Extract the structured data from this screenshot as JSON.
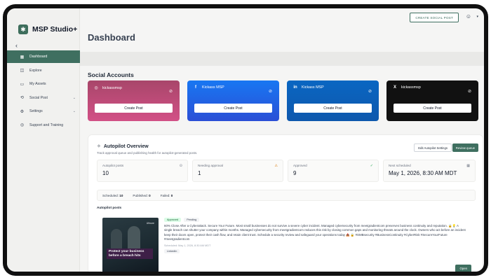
{
  "app": {
    "name": "MSP Studio+",
    "logo_icon": "✱"
  },
  "colors": {
    "accent": "#3f6f60",
    "instagram": "#c14d7c",
    "facebook": "#1877f2",
    "linkedin": "#0a66c2",
    "x": "#111111"
  },
  "sidebar": {
    "collapse_glyph": "‹",
    "items": [
      {
        "label": "Dashboard",
        "icon": "grid-icon",
        "glyph": "▦",
        "active": true
      },
      {
        "label": "Explore",
        "icon": "compass-icon",
        "glyph": "◫"
      },
      {
        "label": "My Assets",
        "icon": "folder-icon",
        "glyph": "▭"
      },
      {
        "label": "Social Post",
        "icon": "share-icon",
        "glyph": "⟲",
        "chevron": "⌄"
      },
      {
        "label": "Settings",
        "icon": "settings-icon",
        "glyph": "⚙",
        "chevron": "⌄"
      },
      {
        "label": "Support and Training",
        "icon": "support-icon",
        "glyph": "◎"
      }
    ]
  },
  "topbar": {
    "create_label": "CREATE SOCIAL POST",
    "user_glyph": "☺",
    "chevron": "▾"
  },
  "page": {
    "title": "Dashboard"
  },
  "social": {
    "title": "Social Accounts",
    "cards": [
      {
        "network": "instagram",
        "glyph": "◎",
        "account": "kickassmsp",
        "button": "Create Post",
        "unlink_glyph": "⊘"
      },
      {
        "network": "facebook",
        "glyph": "f",
        "account": "Kickass MSP",
        "button": "Create Post",
        "unlink_glyph": "⊘"
      },
      {
        "network": "linkedin",
        "glyph": "in",
        "account": "Kickass MSP",
        "button": "Create Post",
        "unlink_glyph": "⊘"
      },
      {
        "network": "x",
        "glyph": "X",
        "account": "kickassmsp",
        "button": "Create Post",
        "unlink_glyph": "⊘"
      }
    ]
  },
  "autopilot": {
    "title": "Autopilot Overview",
    "title_glyph": "✧",
    "subtitle": "Track approval queue and publishing health for autopilot-generated posts.",
    "edit_button": "Edit Autopilot Settings",
    "review_button": "Review queue",
    "stats": [
      {
        "label": "Autopilot posts",
        "value": "10",
        "glyph": "⊙",
        "icon": "clock-icon"
      },
      {
        "label": "Needing approval",
        "value": "1",
        "glyph": "⚠",
        "icon": "warning-icon"
      },
      {
        "label": "Approved",
        "value": "9",
        "glyph": "✓",
        "icon": "check-circle-icon"
      },
      {
        "label": "Next scheduled",
        "value": "May 1, 2026, 8:30 AM MDT",
        "glyph": "▦",
        "icon": "calendar-icon"
      }
    ],
    "summary": {
      "scheduled_label": "Scheduled:",
      "scheduled": "10",
      "published_label": "Published:",
      "published": "0",
      "failed_label": "Failed:",
      "failed": "0"
    },
    "posts_title": "Autopilot posts",
    "post": {
      "badges": [
        "Approved",
        "Pending"
      ],
      "image_brand": "Ufinore",
      "image_headline": "Protect your business before a breach hits",
      "text": "60% Close After a Cyberattack. Secure Your Future. Most small businesses do not survive a severe cyber incident. Managed cybersecurity from meetgradientcom preserves business continuity and reputation. 🔒💡 A single breach can shutter your company within months. Managed cybersecurity from meetgradientcom reduces this risk by closing common gaps and monitoring threats around the clock. Owners who act before an incident keep their doors open, protect their cash flow, and retain client trust. Schedule a security review and safeguard your operations today 📥 🔒 #SMBsecurity #BusinessContinuity #CyberRisk #SecureYourFuture #meetgradientcom",
      "meta": "Scheduled: May 1, 2026, 8:30 AM MDT",
      "network": "LinkedIn",
      "open_button": "Open"
    }
  }
}
